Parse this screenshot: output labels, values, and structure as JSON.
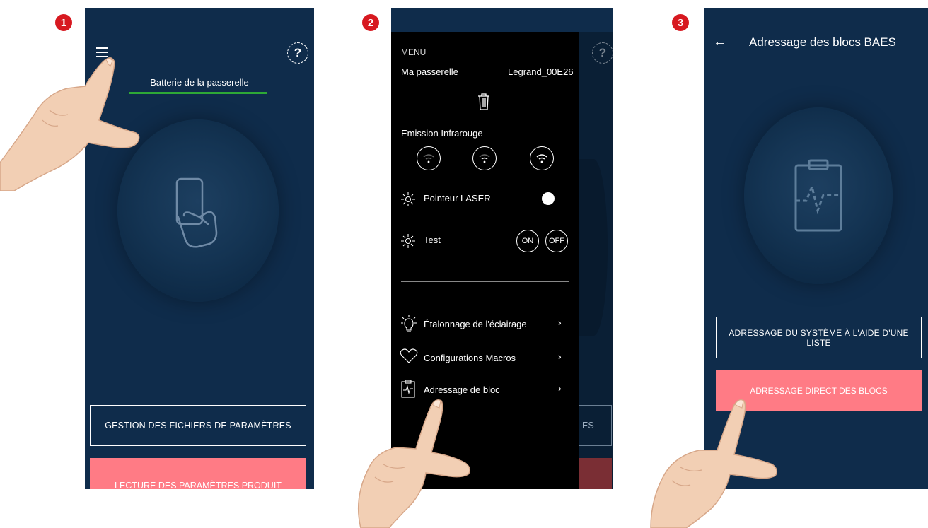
{
  "steps": [
    "1",
    "2",
    "3"
  ],
  "screen1": {
    "menu_icon": "hamburger-menu-icon",
    "help_label": "?",
    "battery_label": "Batterie de la passerelle",
    "battery_color": "#2ea836",
    "center_icon": "phone-in-hand-icon",
    "button_files": "GESTION DES FICHIERS DE PARAMÈTRES",
    "button_read": "LECTURE DES PARAMÈTRES PRODUIT"
  },
  "screen2": {
    "menu_title": "MENU",
    "gateway_label": "Ma passerelle",
    "gateway_name": "Legrand_00E26",
    "delete_icon": "trash-icon",
    "ir_label": "Emission Infrarouge",
    "ir_levels": [
      "wifi-low-icon",
      "wifi-medium-icon",
      "wifi-high-icon"
    ],
    "laser_label": "Pointeur LASER",
    "test_label": "Test",
    "test_on": "ON",
    "test_off": "OFF",
    "items": [
      {
        "label": "Étalonnage de l'éclairage",
        "icon": "bulb-icon"
      },
      {
        "label": "Configurations Macros",
        "icon": "heart-icon"
      },
      {
        "label": "Adressage de bloc",
        "icon": "clipboard-pulse-icon"
      }
    ],
    "behind_help": "?",
    "behind_button_fragment": "ES"
  },
  "screen3": {
    "title": "Adressage des blocs BAES",
    "back_icon": "back-arrow-icon",
    "center_icon": "clipboard-pulse-icon",
    "button_list": "ADRESSAGE DU SYSTÈME À L'AIDE D'UNE LISTE",
    "button_direct": "ADRESSAGE DIRECT DES BLOCS"
  },
  "colors": {
    "screen_bg": "#0f2c4b",
    "accent_pink": "#ff7b85",
    "badge_red": "#d71920"
  }
}
